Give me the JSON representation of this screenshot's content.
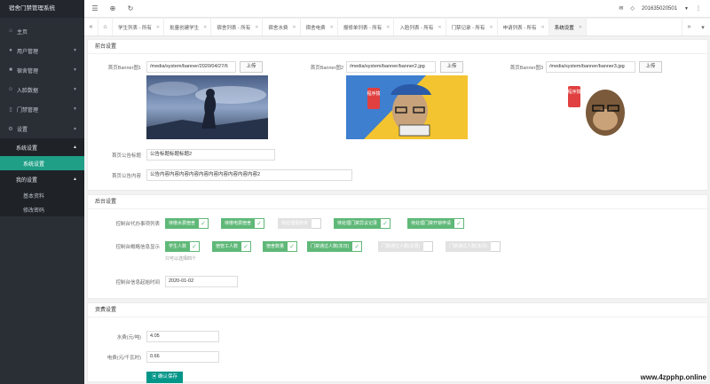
{
  "app": {
    "title": "宿舍门禁管理系统"
  },
  "sidebar": {
    "items": [
      {
        "label": "主页",
        "icon": "home-icon"
      },
      {
        "label": "用户管理",
        "icon": "user-icon"
      },
      {
        "label": "宿舍管理",
        "icon": "building-icon"
      },
      {
        "label": "入脸数据",
        "icon": "face-icon"
      },
      {
        "label": "门禁管理",
        "icon": "door-icon"
      },
      {
        "label": "设置",
        "icon": "gear-icon"
      }
    ],
    "group1": {
      "label": "系统设置",
      "items": [
        "系统设置"
      ]
    },
    "group2": {
      "label": "我的设置",
      "items": [
        "基本资料",
        "修改密码"
      ]
    }
  },
  "topbar": {
    "user": "201635020501"
  },
  "tabs": [
    "学生列表 - 所有",
    "批量创建学生",
    "宿舍列表 - 所有",
    "宿舍水费",
    "宿舍电费",
    "报修单列表 - 所有",
    "入脸列表 - 所有",
    "门禁记录 - 所有",
    "申请列表 - 所有",
    "系统设置"
  ],
  "front": {
    "title": "前台设置",
    "banners": [
      {
        "label": "首页Banner图1",
        "path": "/media/system/banner/2020/04/27/6",
        "upload": "上传"
      },
      {
        "label": "首页Banner图2",
        "path": "/media/system/banner/banner2.jpg",
        "upload": "上传"
      },
      {
        "label": "首页Banner图3",
        "path": "/media/system/banner/banner3.jpg",
        "upload": "上传"
      }
    ],
    "banner_text": "程序猿",
    "notice_title_label": "首页公告标题",
    "notice_title": "公告标题标题标题2",
    "notice_content_label": "首页公告内容",
    "notice_content": "公告内容内容内容内容内容内容内容内容内容内容2"
  },
  "back": {
    "title": "后台设置",
    "todo_label": "控制台代办事项列表",
    "todo_tags": [
      {
        "label": "待缴水费宿舍",
        "on": true
      },
      {
        "label": "待缴电费宿舍",
        "on": true
      },
      {
        "label": "待处理报修单",
        "on": false
      },
      {
        "label": "待处理门禁异议记录",
        "on": true
      },
      {
        "label": "待处理门禁开锁申请",
        "on": true
      }
    ],
    "summary_label": "控制台概略信息显示",
    "summary_tags": [
      {
        "label": "学生人数",
        "on": true
      },
      {
        "label": "宿管工人数",
        "on": true
      },
      {
        "label": "宿舍数量",
        "on": true
      },
      {
        "label": "门禁通过人数(本日)",
        "on": true
      },
      {
        "label": "门禁通过人数(本周)",
        "on": false
      },
      {
        "label": "门禁通过人数(本月)",
        "on": false
      }
    ],
    "summary_hint": "只可以选择四个",
    "start_label": "控制台信息起始时间",
    "start_date": "2020-01-02"
  },
  "fees": {
    "title": "资费设置",
    "water_label": "水费(元/吨)",
    "water": "4.05",
    "elec_label": "电费(元/千瓦时)",
    "elec": "0.66",
    "save": "确认保存"
  },
  "watermark": "www.4zpphp.online"
}
